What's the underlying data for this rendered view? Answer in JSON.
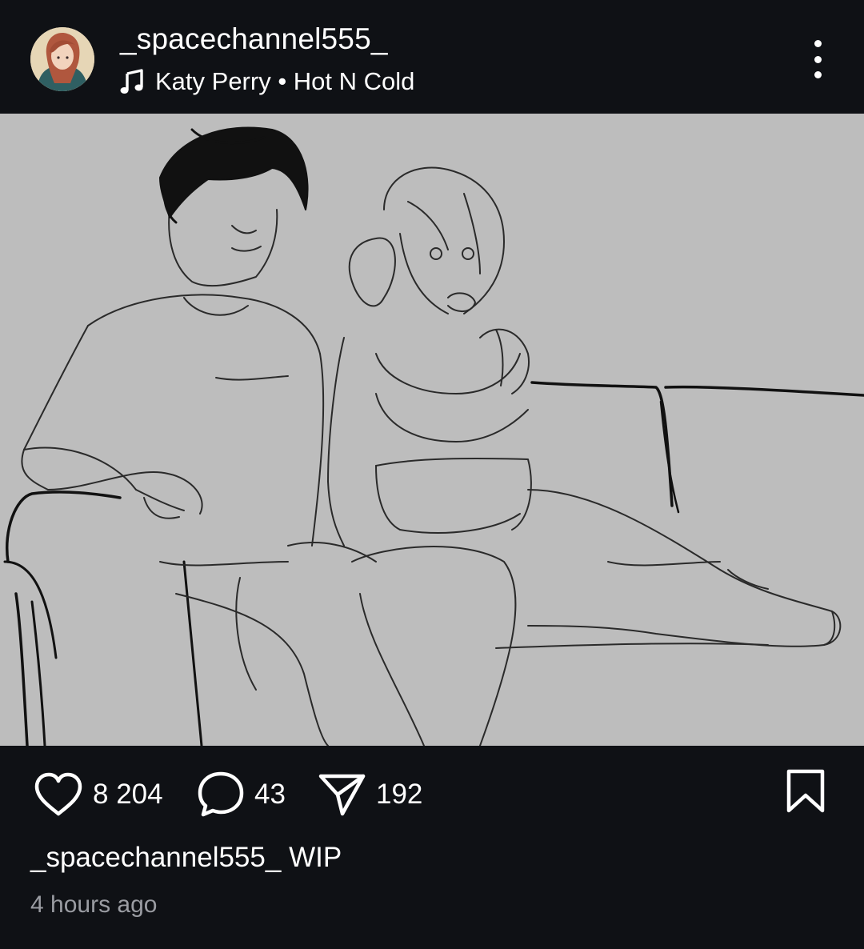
{
  "post": {
    "username": "_spacechannel555_",
    "music": "Katy Perry • Hot N Cold",
    "avatar_icon": "user-avatar",
    "more_icon": "more-vertical-icon",
    "media": {
      "type": "pencil sketch",
      "background_color": "#bdbdbd",
      "mute_icon": "volume-muted-icon"
    },
    "actions": {
      "likes": "8 204",
      "comments": "43",
      "shares": "192",
      "like_icon": "heart-icon",
      "comment_icon": "comment-bubble-icon",
      "share_icon": "paper-plane-icon",
      "bookmark_icon": "bookmark-icon"
    },
    "caption": {
      "username": "_spacechannel555_",
      "text": "WIP"
    },
    "timestamp": "4 hours ago"
  },
  "colors": {
    "background": "#0f1115",
    "text": "#ffffff",
    "muted_text": "#9a9ca2",
    "mute_button": "#55565a"
  }
}
